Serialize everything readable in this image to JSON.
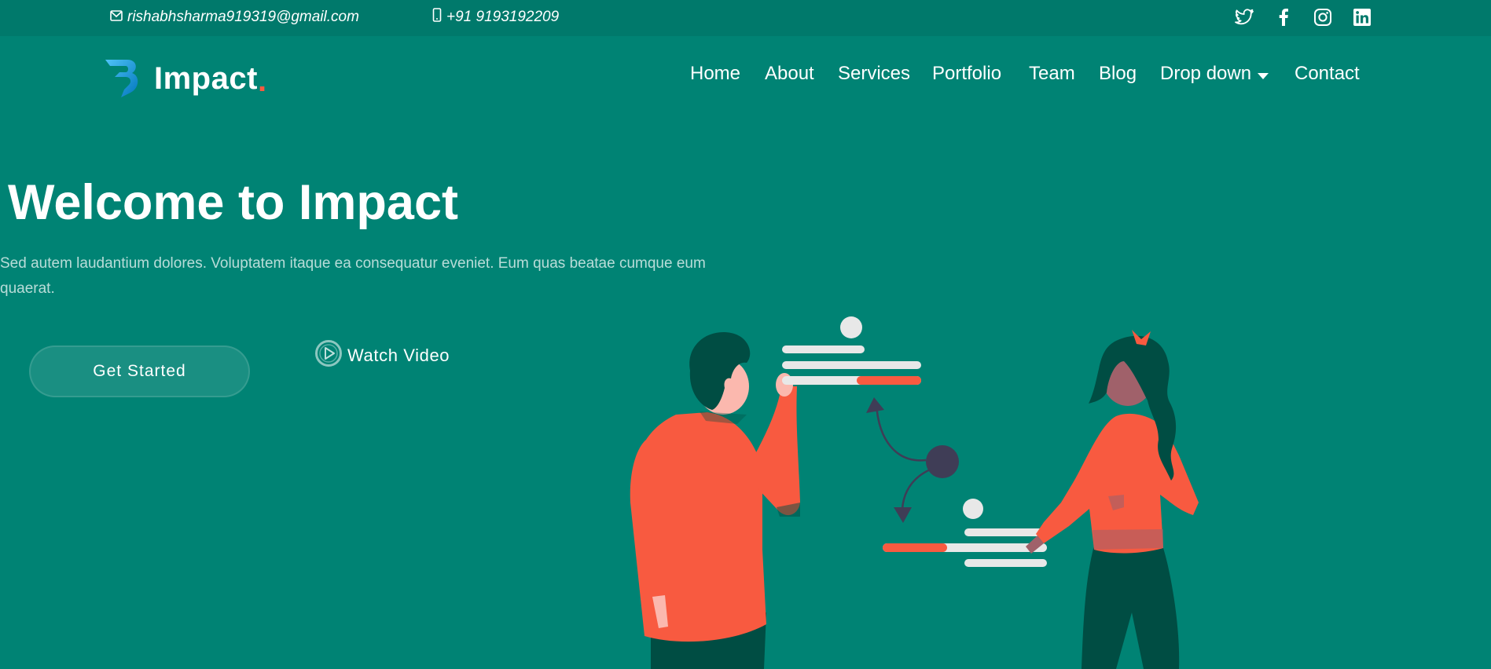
{
  "topbar": {
    "email": "rishabhsharma919319@gmail.com",
    "phone": "+91 9193192209",
    "social_icons": [
      "twitter-icon",
      "facebook-icon",
      "instagram-icon",
      "linkedin-icon"
    ]
  },
  "brand": {
    "name": "Impact",
    "dot": ".",
    "logo_icon": "logo-b-icon"
  },
  "nav": {
    "items": [
      "Home",
      "About",
      "Services",
      "Portfolio",
      "Team",
      "Blog",
      "Drop down",
      "Contact"
    ]
  },
  "hero": {
    "title": "Welcome to Impact",
    "description": "Sed autem laudantium dolores. Voluptatem itaque ea consequatur eveniet. Eum quas beatae cumque eum quaerat.",
    "primary_button": "Get Started",
    "video_button": "Watch Video"
  },
  "colors": {
    "background": "#008374",
    "topbar": "#00796b",
    "accent": "#f85a40",
    "dark_green": "#004d43"
  }
}
